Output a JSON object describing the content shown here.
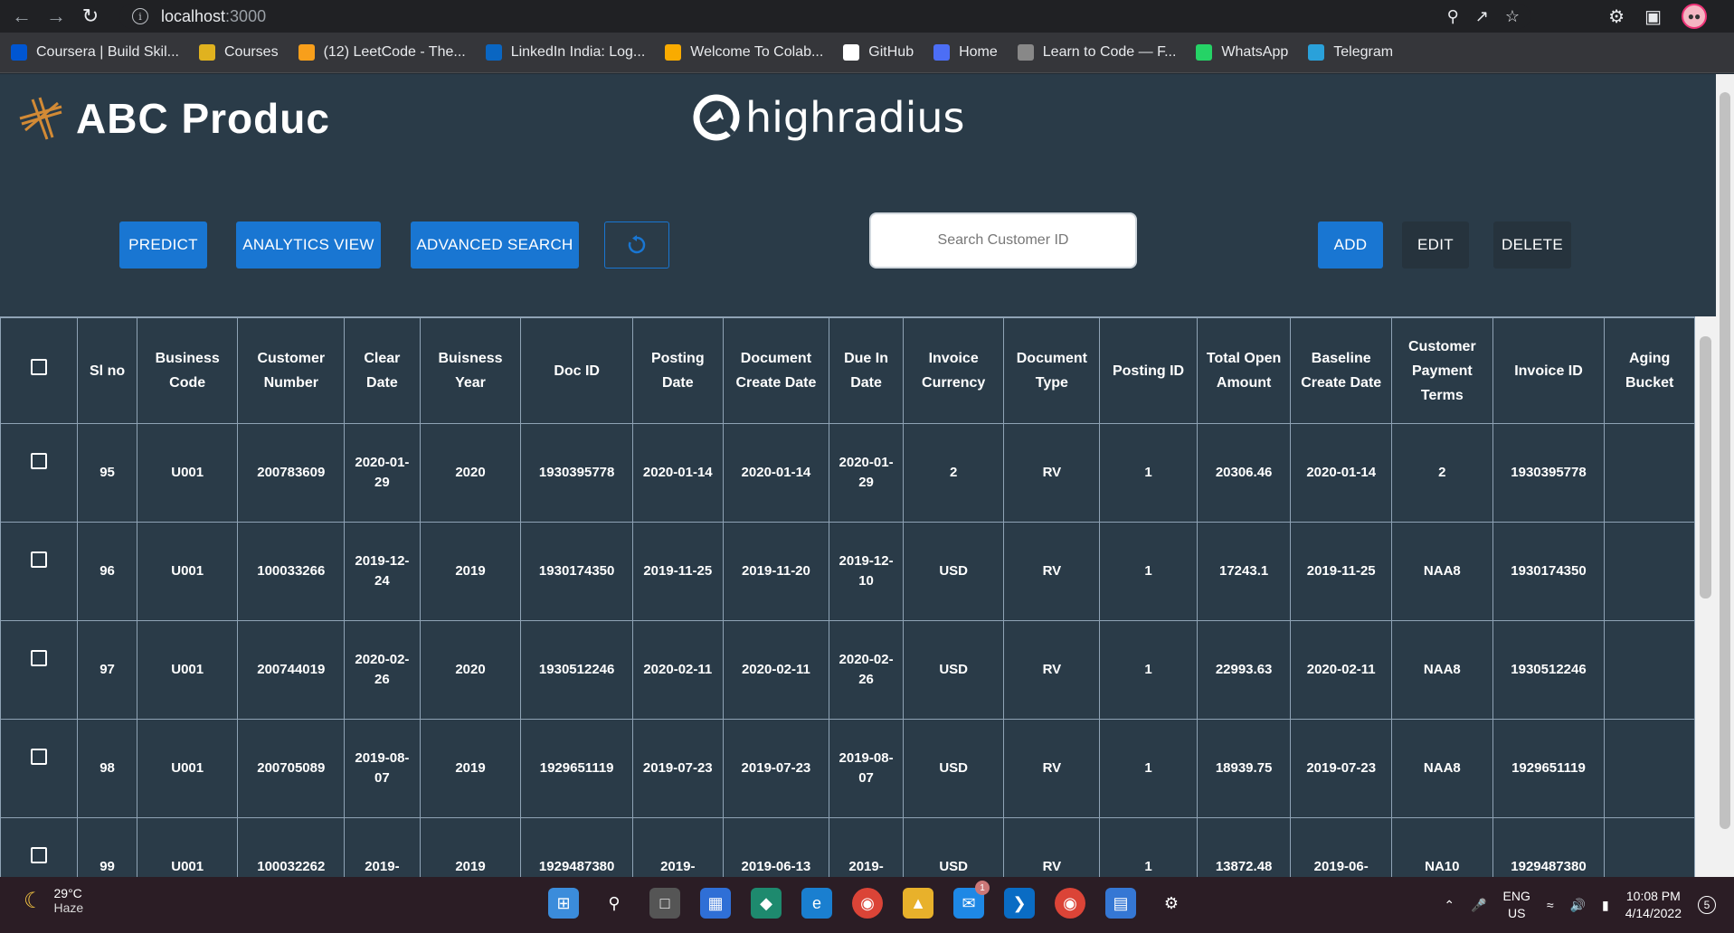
{
  "browser": {
    "url_host": "localhost",
    "url_port": ":3000",
    "bookmarks": [
      {
        "label": "Coursera | Build Skil...",
        "icon": "coursera-icon",
        "color": "#0056d2"
      },
      {
        "label": "Courses",
        "icon": "courses-icon",
        "color": "#e0b21f"
      },
      {
        "label": "(12) LeetCode - The...",
        "icon": "leetcode-icon",
        "color": "#f89f1b"
      },
      {
        "label": "LinkedIn India: Log...",
        "icon": "linkedin-icon",
        "color": "#0a66c2"
      },
      {
        "label": "Welcome To Colab...",
        "icon": "colab-icon",
        "color": "#f9ab00"
      },
      {
        "label": "GitHub",
        "icon": "github-icon",
        "color": "#ffffff"
      },
      {
        "label": "Home",
        "icon": "home-icon",
        "color": "#4c6ef5"
      },
      {
        "label": "Learn to Code — F...",
        "icon": "freecodecamp-icon",
        "color": "#888888"
      },
      {
        "label": "WhatsApp",
        "icon": "whatsapp-icon",
        "color": "#25d366"
      },
      {
        "label": "Telegram",
        "icon": "telegram-icon",
        "color": "#2aa1da"
      }
    ]
  },
  "app": {
    "brand": "ABC Produc",
    "partner_logo": "highradius",
    "buttons": {
      "predict": "PREDICT",
      "analytics": "ANALYTICS VIEW",
      "advanced_search": "ADVANCED SEARCH",
      "add": "ADD",
      "edit": "EDIT",
      "delete": "DELETE"
    },
    "search": {
      "placeholder": "Search Customer ID"
    },
    "table": {
      "headers": [
        "Sl no",
        "Business Code",
        "Customer Number",
        "Clear Date",
        "Buisness Year",
        "Doc ID",
        "Posting Date",
        "Document Create Date",
        "Due In Date",
        "Invoice Currency",
        "Document Type",
        "Posting ID",
        "Total Open Amount",
        "Baseline Create Date",
        "Customer Payment Terms",
        "Invoice ID",
        "Aging Bucket"
      ],
      "rows": [
        [
          "95",
          "U001",
          "200783609",
          "2020-01-29",
          "2020",
          "1930395778",
          "2020-01-14",
          "2020-01-14",
          "2020-01-29",
          "2",
          "RV",
          "1",
          "20306.46",
          "2020-01-14",
          "2",
          "1930395778",
          ""
        ],
        [
          "96",
          "U001",
          "100033266",
          "2019-12-24",
          "2019",
          "1930174350",
          "2019-11-25",
          "2019-11-20",
          "2019-12-10",
          "USD",
          "RV",
          "1",
          "17243.1",
          "2019-11-25",
          "NAA8",
          "1930174350",
          ""
        ],
        [
          "97",
          "U001",
          "200744019",
          "2020-02-26",
          "2020",
          "1930512246",
          "2020-02-11",
          "2020-02-11",
          "2020-02-26",
          "USD",
          "RV",
          "1",
          "22993.63",
          "2020-02-11",
          "NAA8",
          "1930512246",
          ""
        ],
        [
          "98",
          "U001",
          "200705089",
          "2019-08-07",
          "2019",
          "1929651119",
          "2019-07-23",
          "2019-07-23",
          "2019-08-07",
          "USD",
          "RV",
          "1",
          "18939.75",
          "2019-07-23",
          "NAA8",
          "1929651119",
          ""
        ],
        [
          "99",
          "U001",
          "100032262",
          "2019-",
          "2019",
          "1929487380",
          "2019-",
          "2019-06-13",
          "2019-",
          "USD",
          "RV",
          "1",
          "13872.48",
          "2019-06-",
          "NA10",
          "1929487380",
          ""
        ]
      ]
    },
    "colors": {
      "background": "#2a3b48",
      "accent": "#1976d2"
    }
  },
  "taskbar": {
    "temperature": "29°C",
    "condition": "Haze",
    "lang1": "ENG",
    "lang2": "US",
    "time": "10:08 PM",
    "date": "4/14/2022",
    "notif_count": "5",
    "mail_badge": "1"
  }
}
